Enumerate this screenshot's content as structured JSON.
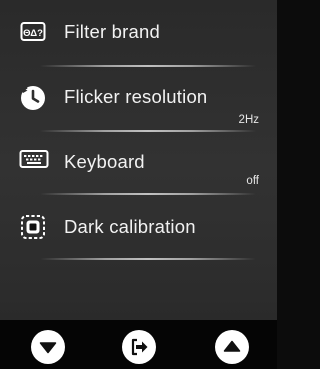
{
  "menu": {
    "items": [
      {
        "label": "Filter brand",
        "value": "",
        "icon": "filter-brand-icon"
      },
      {
        "label": "Flicker resolution",
        "value": "2Hz",
        "icon": "clock-history-icon"
      },
      {
        "label": "Keyboard",
        "value": "off",
        "icon": "keyboard-icon"
      },
      {
        "label": "Dark calibration",
        "value": "",
        "icon": "dark-calibration-icon"
      }
    ]
  },
  "nav": {
    "buttons": [
      {
        "icon": "down-arrow-icon"
      },
      {
        "icon": "exit-icon"
      },
      {
        "icon": "up-arrow-icon"
      }
    ]
  },
  "colors": {
    "background": "#2e2e2e",
    "bottom_bar": "#050505",
    "text": "#f2f2f2",
    "button": "#ffffff"
  }
}
